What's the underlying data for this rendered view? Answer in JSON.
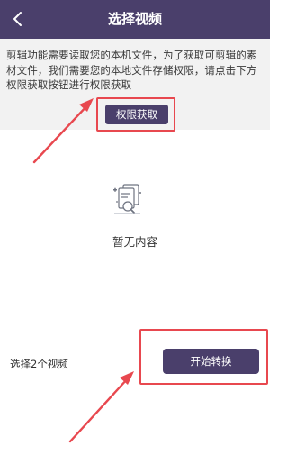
{
  "header": {
    "title": "选择视频",
    "back_icon": "chevron-left-icon"
  },
  "notice": {
    "text": "剪辑功能需要读取您的本机文件，为了获取可剪辑的素材文件，我们需要您的本地文件存储权限，请点击下方权限获取按钮进行权限获取",
    "permission_button_label": "权限获取"
  },
  "empty_state": {
    "icon": "document-search-icon",
    "text": "暂无内容"
  },
  "footer": {
    "selected_text": "选择2个视频",
    "start_button_label": "开始转换"
  },
  "colors": {
    "primary": "#4a3f6b",
    "highlight": "#e8484f",
    "notice_bg": "#f2f2f2"
  }
}
